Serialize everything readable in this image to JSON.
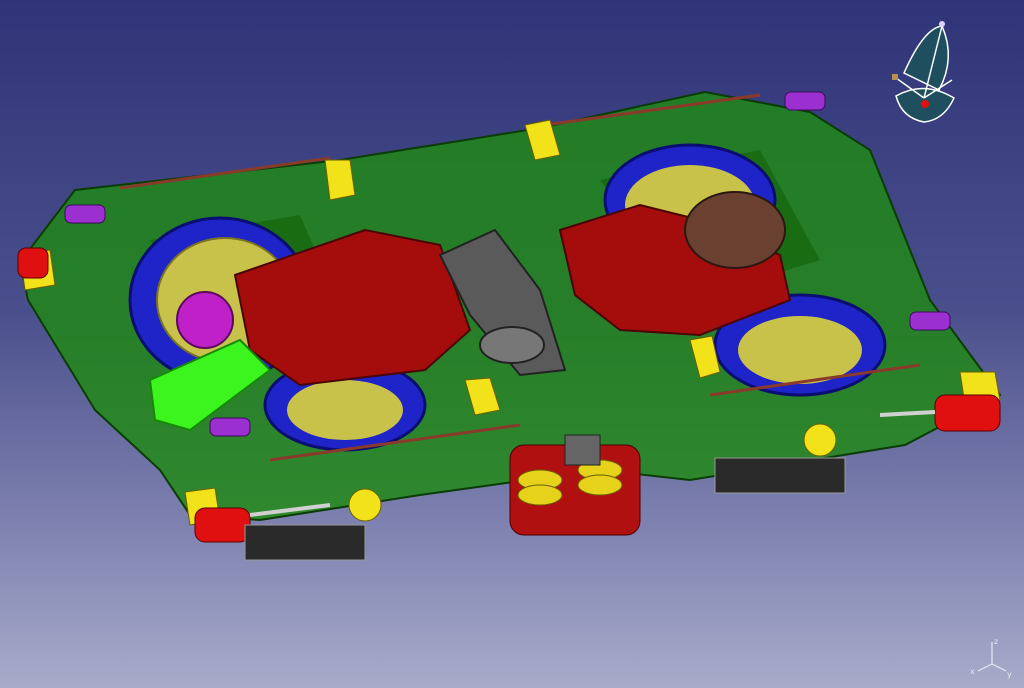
{
  "viewer": {
    "background_top": "#2f3478",
    "background_bottom": "#a9abca"
  },
  "model": {
    "subject": "railway-bogie-assembly",
    "colors": {
      "frame": "#1f8a12",
      "wheel_rim": "#1f24c8",
      "wheel_disc": "#c9c24a",
      "gearbox": "#a50d0d",
      "axlebox_arm": "#3cf51e",
      "bracket": "#f2e21a",
      "clamp": "#9b2fd0",
      "damper": "#e01010",
      "spring": "#e6d21a",
      "gear": "#6a4030",
      "pivot": "#555555"
    }
  },
  "compass": {
    "icon": "compass-icon",
    "accent": "#1f4f5f"
  },
  "axis_triad": {
    "icon": "axis-triad-icon",
    "labels": {
      "x": "x",
      "y": "y",
      "z": "z"
    }
  }
}
